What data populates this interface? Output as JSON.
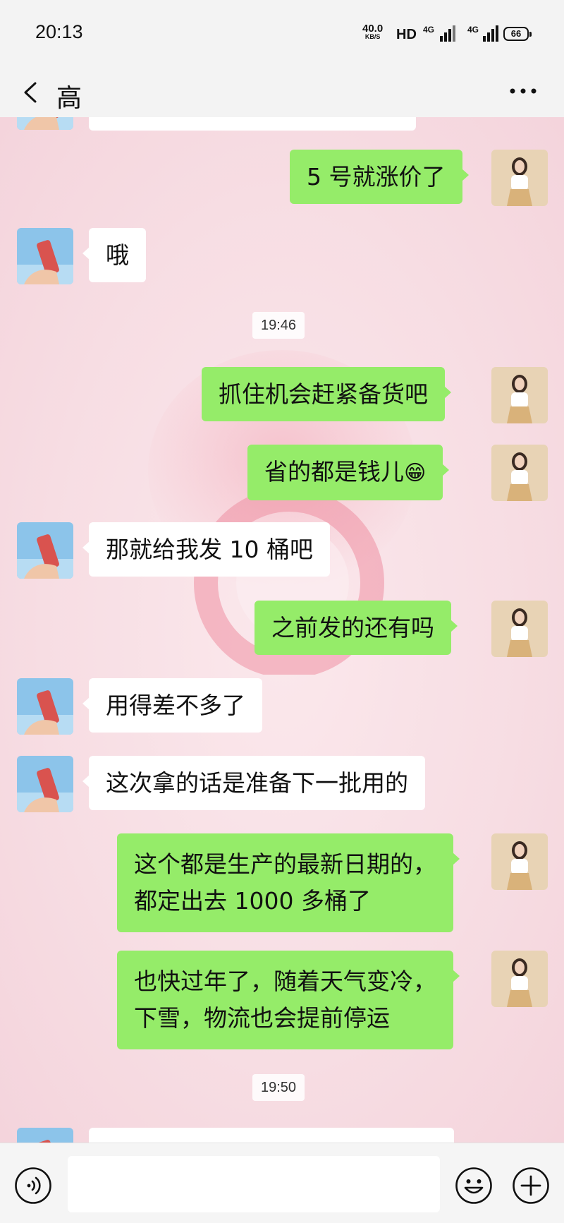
{
  "status_bar": {
    "time": "20:13",
    "net_speed_value": "40.0",
    "net_speed_unit": "KB/S",
    "hd_label": "HD",
    "signal_1_label": "4G",
    "signal_2_label": "4G",
    "battery_level": "66"
  },
  "header": {
    "title": "高",
    "back_icon": "chevron-left-icon",
    "more_icon": "more-dots-icon"
  },
  "messages": [
    {
      "side": "out",
      "text": "5 号就涨价了"
    },
    {
      "side": "in",
      "text": "哦"
    },
    {
      "type": "time",
      "text": "19:46"
    },
    {
      "side": "out",
      "text": "抓住机会赶紧备货吧"
    },
    {
      "side": "out",
      "text": "省的都是钱儿",
      "emoji": "😁"
    },
    {
      "side": "in",
      "text": "那就给我发 10 桶吧"
    },
    {
      "side": "out",
      "text": "之前发的还有吗"
    },
    {
      "side": "in",
      "text": "用得差不多了"
    },
    {
      "side": "in",
      "text": "这次拿的话是准备下一批用的"
    },
    {
      "side": "out",
      "lines": [
        "这个都是生产的最新日期的，",
        "都定出去 1000 多桶了"
      ]
    },
    {
      "side": "out",
      "lines": [
        "也快过年了，随着天气变冷，",
        "下雪，物流也会提前停运"
      ]
    },
    {
      "type": "time",
      "text": "19:50"
    }
  ],
  "input_bar": {
    "voice_icon": "voice-icon",
    "emoji_icon": "emoji-smile-icon",
    "plus_icon": "plus-circle-icon",
    "input_value": ""
  },
  "colors": {
    "outgoing_bubble": "#95ec69",
    "incoming_bubble": "#ffffff",
    "chat_background": "#f7dde3",
    "bar_background": "#f3f3f3"
  }
}
